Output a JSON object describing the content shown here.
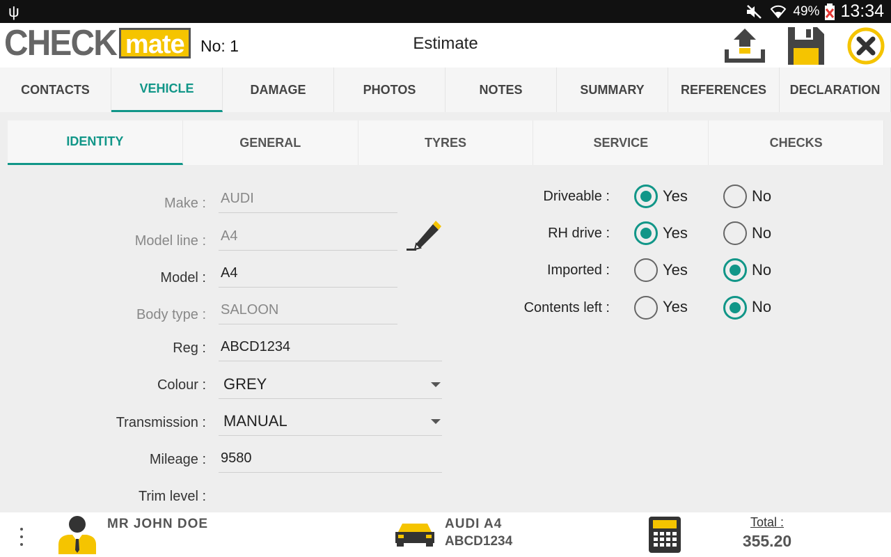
{
  "status_bar": {
    "battery": "49%",
    "time": "13:34"
  },
  "header": {
    "logo_check": "CHECK",
    "logo_mate": "mate",
    "number": "No: 1",
    "title": "Estimate"
  },
  "tabs": [
    {
      "label": "CONTACTS"
    },
    {
      "label": "VEHICLE"
    },
    {
      "label": "DAMAGE"
    },
    {
      "label": "PHOTOS"
    },
    {
      "label": "NOTES"
    },
    {
      "label": "SUMMARY"
    },
    {
      "label": "REFERENCES"
    },
    {
      "label": "DECLARATION"
    }
  ],
  "active_tab": "VEHICLE",
  "subtabs": [
    {
      "label": "IDENTITY"
    },
    {
      "label": "GENERAL"
    },
    {
      "label": "TYRES"
    },
    {
      "label": "SERVICE"
    },
    {
      "label": "CHECKS"
    }
  ],
  "active_subtab": "IDENTITY",
  "form": {
    "make": {
      "label": "Make :",
      "value": "AUDI"
    },
    "model_line": {
      "label": "Model line :",
      "value": "A4"
    },
    "model": {
      "label": "Model :",
      "value": "A4"
    },
    "body_type": {
      "label": "Body type :",
      "value": "SALOON"
    },
    "reg": {
      "label": "Reg :",
      "value": "ABCD1234"
    },
    "colour": {
      "label": "Colour :",
      "value": "GREY"
    },
    "transmission": {
      "label": "Transmission :",
      "value": "MANUAL"
    },
    "mileage": {
      "label": "Mileage :",
      "value": "9580"
    },
    "trim_level": {
      "label": "Trim level :",
      "value": ""
    }
  },
  "radios": {
    "yes_label": "Yes",
    "no_label": "No",
    "driveable": {
      "label": "Driveable :",
      "selected": "Yes"
    },
    "rh_drive": {
      "label": "RH drive :",
      "selected": "Yes"
    },
    "imported": {
      "label": "Imported :",
      "selected": "No"
    },
    "contents_left": {
      "label": "Contents left :",
      "selected": "No"
    }
  },
  "footer": {
    "contact_name": "MR  JOHN  DOE",
    "vehicle_line1": "AUDI  A4",
    "vehicle_line2": "ABCD1234",
    "total_label": "Total :",
    "total_value": "355.20"
  },
  "colors": {
    "accent": "#119688",
    "brand_yellow": "#f5c400"
  }
}
